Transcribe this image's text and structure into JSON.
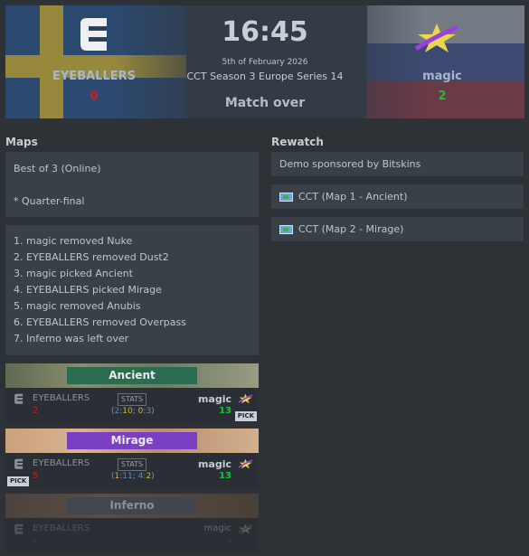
{
  "match": {
    "time": "16:45",
    "date": "5th of February 2026",
    "event": "CCT Season 3 Europe Series 14",
    "status": "Match over"
  },
  "team1": {
    "name": "EYEBALLERS",
    "score": "0"
  },
  "team2": {
    "name": "magic",
    "score": "2"
  },
  "sections": {
    "maps": "Maps",
    "rewatch": "Rewatch"
  },
  "format": {
    "line1": "Best of 3 (Online)",
    "line2": "* Quarter-final"
  },
  "veto": [
    "1. magic removed Nuke",
    "2. EYEBALLERS removed Dust2",
    "3. magic picked Ancient",
    "4. EYEBALLERS picked Mirage",
    "5. magic removed Anubis",
    "6. EYEBALLERS removed Overpass",
    "7. Inferno was left over"
  ],
  "rewatch": {
    "sponsor": "Demo sponsored by Bitskins",
    "demos": [
      "CCT (Map 1 - Ancient)",
      "CCT (Map 2 - Mirage)"
    ]
  },
  "maps": [
    {
      "name": "Ancient",
      "team1": "EYEBALLERS",
      "team2": "magic",
      "score1": "2",
      "score2": "13",
      "stats": "STATS",
      "half": {
        "open": "(",
        "a": "2",
        "sep1": ":",
        "b": "10",
        "sep2": "; ",
        "c": "0",
        "sep3": ":",
        "d": "3",
        "close": ")"
      },
      "pick": "PICK",
      "pick_side": "team2"
    },
    {
      "name": "Mirage",
      "team1": "EYEBALLERS",
      "team2": "magic",
      "score1": "5",
      "score2": "13",
      "stats": "STATS",
      "half": {
        "open": "(",
        "a": "1",
        "sep1": ":",
        "b": "11",
        "sep2": "; ",
        "c": "4",
        "sep3": ":",
        "d": "2",
        "close": ")"
      },
      "pick": "PICK",
      "pick_side": "team1"
    },
    {
      "name": "Inferno",
      "team1": "EYEBALLERS",
      "team2": "magic",
      "score1": "-",
      "score2": "-"
    }
  ],
  "colors": {
    "loss": "#d01c1c",
    "win": "#1fbf3a",
    "ancient_strip": "#2b6b4f",
    "mirage_strip": "#7b3fc4"
  }
}
